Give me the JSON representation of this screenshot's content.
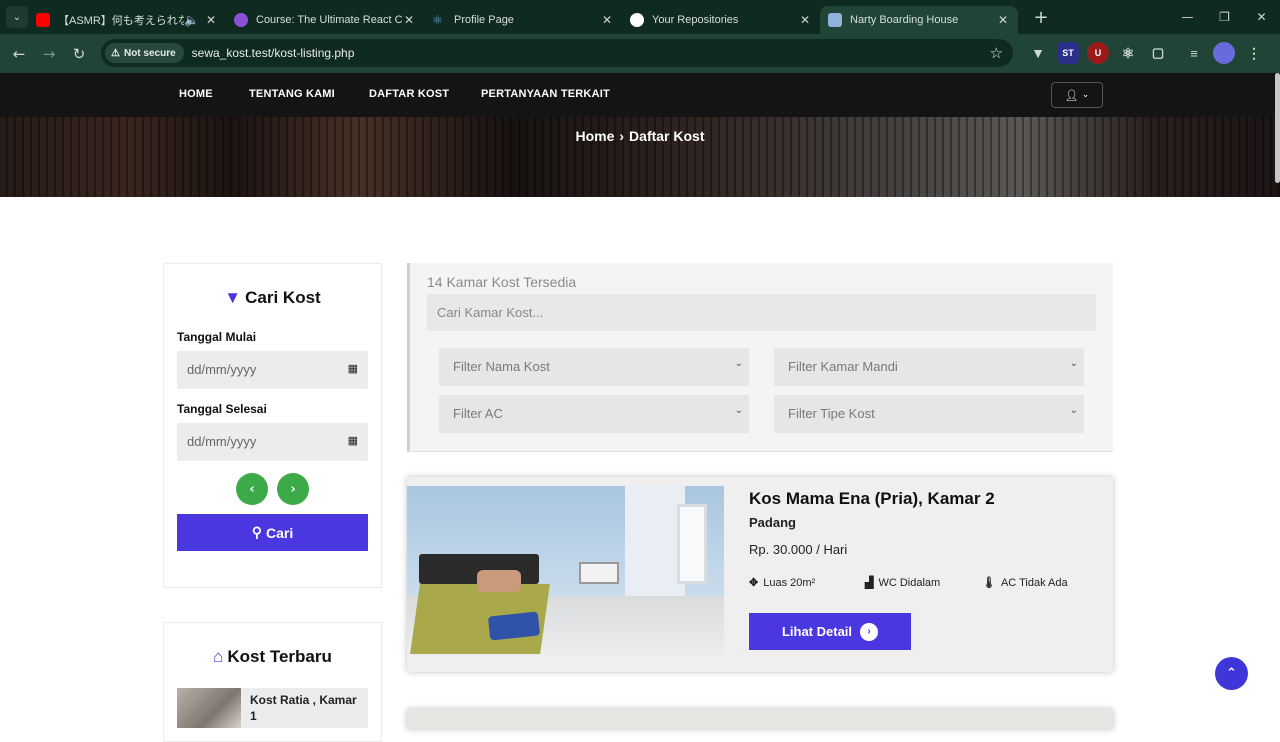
{
  "browser": {
    "tabs": [
      {
        "title": "【ASMR】何も考えられなくなる",
        "favicon_color": "#ff0000",
        "active": false
      },
      {
        "title": "Course: The Ultimate React Cou",
        "favicon_color": "#8b4fd8",
        "active": false
      },
      {
        "title": "Profile Page",
        "favicon_color": "#5aa7d8",
        "active": false
      },
      {
        "title": "Your Repositories",
        "favicon_color": "#ffffff",
        "active": false
      },
      {
        "title": "Narty Boarding House",
        "favicon_color": "#8fb3d9",
        "active": true
      }
    ],
    "security_label": "Not secure",
    "url": "sewa_kost.test/kost-listing.php",
    "extensions": [
      "ST",
      "U"
    ]
  },
  "nav": {
    "items": [
      "HOME",
      "TENTANG KAMI",
      "DAFTAR KOST",
      "PERTANYAAN TERKAIT"
    ]
  },
  "breadcrumb": {
    "home": "Home",
    "current": "Daftar Kost"
  },
  "sidebar": {
    "search_title": "Cari Kost",
    "start_label": "Tanggal Mulai",
    "end_label": "Tanggal Selesai",
    "date_placeholder": "dd/mm/yyyy",
    "search_button": "Cari",
    "recent_title": "Kost Terbaru",
    "recent_item": "Kost Ratia , Kamar 1"
  },
  "filters": {
    "count_text": "14 Kamar Kost Tersedia",
    "search_placeholder": "Cari Kamar Kost...",
    "selects": [
      "Filter Nama Kost",
      "Filter Kamar Mandi",
      "Filter AC",
      "Filter Tipe Kost"
    ]
  },
  "listing": {
    "title": "Kos Mama Ena (Pria), Kamar 2",
    "city": "Padang",
    "price": "Rp. 30.000 / Hari",
    "features": [
      "Luas 20m²",
      "WC Didalam",
      "AC Tidak Ada"
    ],
    "button": "Lihat Detail"
  },
  "colors": {
    "accent": "#4a37e0",
    "green": "#3daa4a",
    "nav_bg": "#141414"
  }
}
